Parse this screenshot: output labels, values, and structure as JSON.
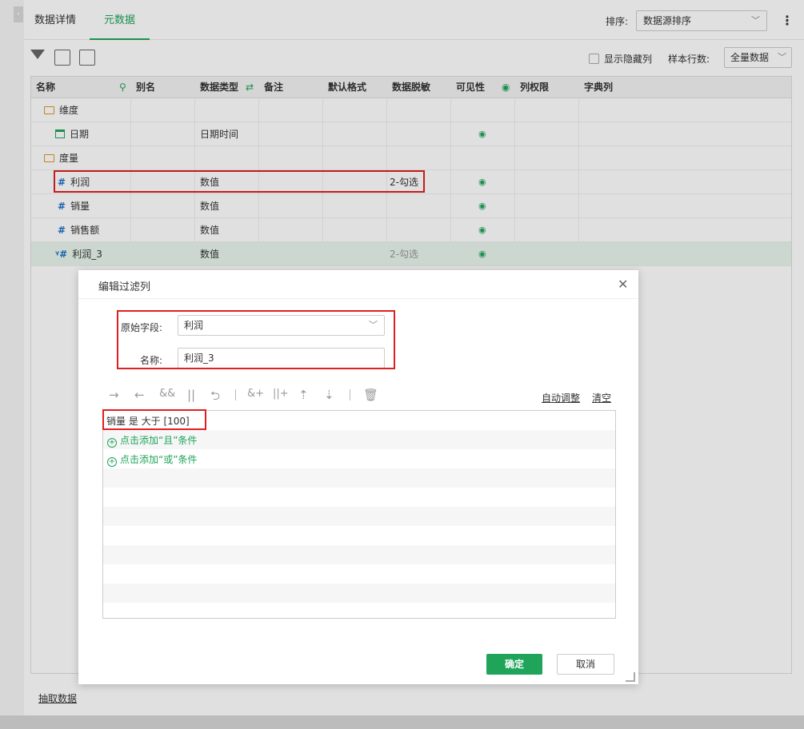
{
  "tabs": [
    "数据详情",
    "元数据"
  ],
  "sort": {
    "label": "排序:",
    "value": "数据源排序"
  },
  "toolbar": {
    "show_hidden": "显示隐藏列",
    "sample_label": "样本行数:",
    "sample_value": "全量数据"
  },
  "grid": {
    "headers": [
      "名称",
      "别名",
      "数据类型",
      "备注",
      "默认格式",
      "数据脱敏",
      "可见性",
      "列权限",
      "字典列"
    ],
    "rows": [
      {
        "name": "维度",
        "type": "",
        "mask": "",
        "visible": ""
      },
      {
        "name": "日期",
        "type": "日期时间",
        "mask": "",
        "visible": "◉"
      },
      {
        "name": "度量",
        "type": "",
        "mask": "",
        "visible": ""
      },
      {
        "name": "利润",
        "type": "数值",
        "mask": "2-勾选",
        "visible": "◉"
      },
      {
        "name": "销量",
        "type": "数值",
        "mask": "",
        "visible": "◉"
      },
      {
        "name": "销售额",
        "type": "数值",
        "mask": "",
        "visible": "◉"
      },
      {
        "name": "利润_3",
        "type": "数值",
        "mask": "2-勾选",
        "visible": "◉"
      }
    ]
  },
  "extract": "抽取数据",
  "dialog": {
    "title": "编辑过滤列",
    "source_label": "原始字段:",
    "source_value": "利润",
    "name_label": "名称:",
    "name_value": "利润_3",
    "auto_adjust": "自动调整",
    "clear": "清空",
    "condition": "销量 是 大于 [100]",
    "add_and": "点击添加“且”条件",
    "add_or": "点击添加“或”条件",
    "ok": "确定",
    "cancel": "取消"
  },
  "colors": {
    "accent": "#1fa45a",
    "highlight": "#e02020"
  }
}
